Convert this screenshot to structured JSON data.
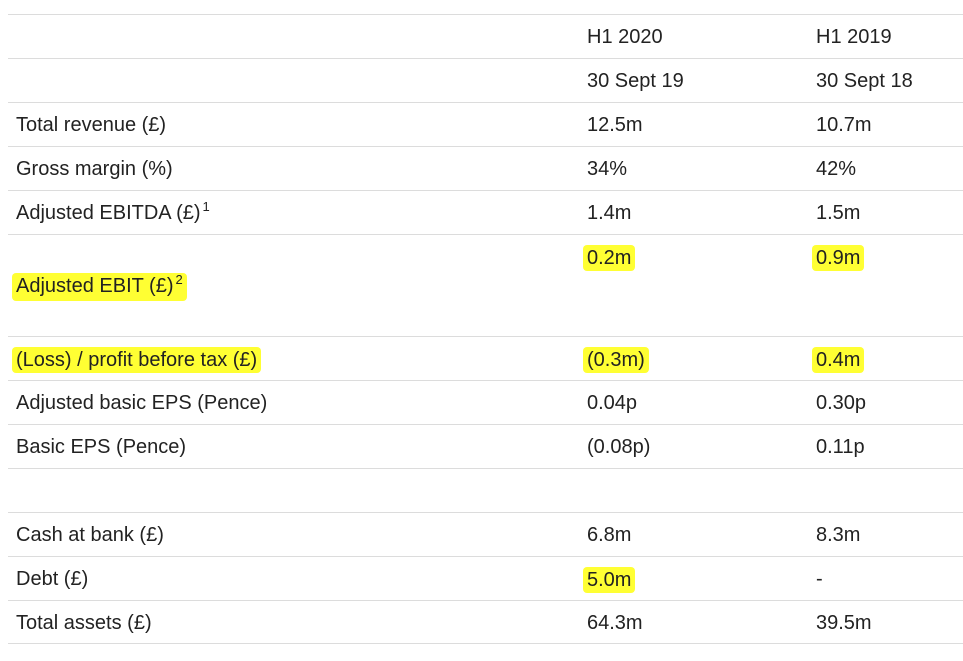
{
  "header": {
    "col1": "H1 2020",
    "col2": "H1 2019",
    "date1": "30 Sept 19",
    "date2": "30 Sept 18"
  },
  "rows": [
    {
      "label": "Total revenue (£)",
      "v1": "12.5m",
      "v2": "10.7m"
    },
    {
      "label": "Gross margin (%)",
      "v1": "34%",
      "v2": "42%"
    },
    {
      "label": "Adjusted EBITDA (£)",
      "sup": "1",
      "v1": "1.4m",
      "v2": "1.5m"
    },
    {
      "label": "Adjusted EBIT (£)",
      "sup": "2",
      "v1": "0.2m",
      "v2": "0.9m"
    },
    {
      "label": "(Loss) / profit before tax (£)",
      "v1": "(0.3m)",
      "v2": "0.4m"
    },
    {
      "label": "Adjusted basic EPS (Pence)",
      "v1": "0.04p",
      "v2": "0.30p"
    },
    {
      "label": "Basic EPS (Pence)",
      "v1": "(0.08p)",
      "v2": "0.11p"
    },
    {
      "label": "Cash at bank (£)",
      "v1": "6.8m",
      "v2": "8.3m"
    },
    {
      "label": "Debt (£)",
      "v1": "5.0m",
      "v2": "-"
    },
    {
      "label": "Total assets (£)",
      "v1": "64.3m",
      "v2": "39.5m"
    }
  ],
  "highlight_color": "#ffff33",
  "border_color": "#dcdcdc"
}
